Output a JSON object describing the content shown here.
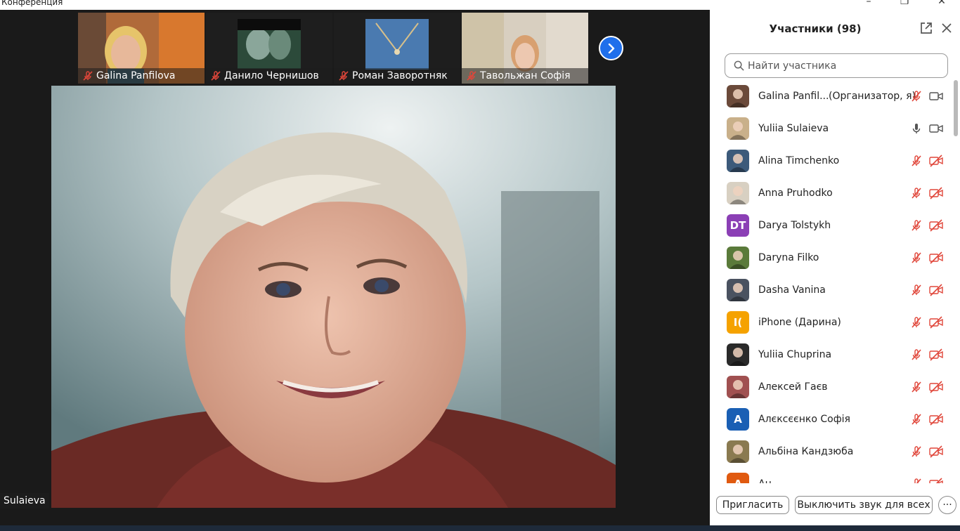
{
  "window": {
    "title": "Конференция",
    "minimize": "–",
    "restore": "❐",
    "close": "✕"
  },
  "thumbnails": [
    {
      "name": "Galina Panfilova"
    },
    {
      "name": "Данило Чернишов"
    },
    {
      "name": "Роман Заворотняк"
    },
    {
      "name": "Тавольжан Софія"
    }
  ],
  "active_speaker": {
    "label": "Sulaieva"
  },
  "panel": {
    "title": "Участники (98)",
    "search_placeholder": "Найти участника",
    "participants": [
      {
        "name": "Galina Panfil...",
        "role": "(Организатор, я)",
        "mic": "off",
        "cam": "on",
        "avatar": "photo",
        "color": "#6b4a3a"
      },
      {
        "name": "Yuliia Sulaieva",
        "role": "",
        "mic": "on",
        "cam": "on",
        "avatar": "photo",
        "color": "#c9b08a"
      },
      {
        "name": "Alina Timchenko",
        "role": "",
        "mic": "off",
        "cam": "off",
        "avatar": "photo",
        "color": "#3c5a7a"
      },
      {
        "name": "Anna Pruhodko",
        "role": "",
        "mic": "off",
        "cam": "off",
        "avatar": "photo",
        "color": "#d8d0c2"
      },
      {
        "name": "Darya Tolstykh",
        "role": "",
        "mic": "off",
        "cam": "off",
        "avatar": "initials",
        "initials": "DT",
        "color": "#8b3fb5"
      },
      {
        "name": "Daryna Filko",
        "role": "",
        "mic": "off",
        "cam": "off",
        "avatar": "photo",
        "color": "#5a7a3a"
      },
      {
        "name": "Dasha Vanina",
        "role": "",
        "mic": "off",
        "cam": "off",
        "avatar": "photo",
        "color": "#4a5260"
      },
      {
        "name": "iPhone (Дарина)",
        "role": "",
        "mic": "off",
        "cam": "off",
        "avatar": "initials",
        "initials": "I(",
        "color": "#f5a200"
      },
      {
        "name": "Yuliia Chuprina",
        "role": "",
        "mic": "off",
        "cam": "off",
        "avatar": "photo",
        "color": "#2a2a2a"
      },
      {
        "name": "Алексей Гаєв",
        "role": "",
        "mic": "off",
        "cam": "off",
        "avatar": "photo",
        "color": "#a05050"
      },
      {
        "name": "Алєксєєнко Софія",
        "role": "",
        "mic": "off",
        "cam": "off",
        "avatar": "initials",
        "initials": "A",
        "color": "#1a5fb4"
      },
      {
        "name": "Альбіна Кандзюба",
        "role": "",
        "mic": "off",
        "cam": "off",
        "avatar": "photo",
        "color": "#8a7a50"
      },
      {
        "name": "Ан",
        "role": "",
        "mic": "off",
        "cam": "off",
        "avatar": "initials",
        "initials": "A",
        "color": "#e05a10"
      }
    ],
    "invite_label": "Пригласить",
    "mute_all_label": "Выключить звук для всех",
    "more_label": "···"
  },
  "colors": {
    "mic_off": "#e0463a",
    "accent": "#1f6feb"
  }
}
